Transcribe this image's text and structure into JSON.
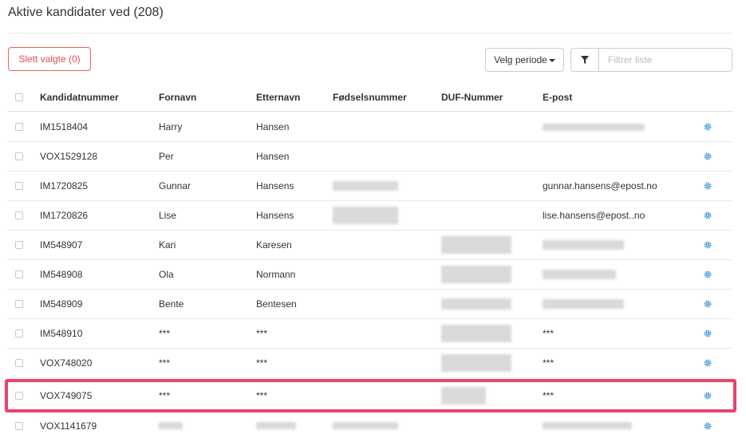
{
  "page": {
    "title": "Aktive kandidater ved (208)"
  },
  "toolbar": {
    "delete_label": "Slett valgte (0)",
    "period_label": "Velg periode",
    "filter_placeholder": "Filtrer liste"
  },
  "table": {
    "headers": {
      "kandidatnummer": "Kandidatnummer",
      "fornavn": "Fornavn",
      "etternavn": "Etternavn",
      "fodselsnummer": "Fødselsnummer",
      "duf": "DUF-Nummer",
      "epost": "E-post"
    },
    "rows": [
      {
        "kandidatnummer": "IM1518404",
        "fornavn": "Harry",
        "etternavn": "Hansen",
        "epost": ""
      },
      {
        "kandidatnummer": "VOX1529128",
        "fornavn": "Per",
        "etternavn": "Hansen",
        "epost": ""
      },
      {
        "kandidatnummer": "IM1720825",
        "fornavn": "Gunnar",
        "etternavn": "Hansens",
        "epost": "gunnar.hansens@epost.no"
      },
      {
        "kandidatnummer": "IM1720826",
        "fornavn": "Lise",
        "etternavn": "Hansens",
        "epost": "lise.hansens@epost..no"
      },
      {
        "kandidatnummer": "IM548907",
        "fornavn": "Kari",
        "etternavn": "Karesen",
        "epost": ""
      },
      {
        "kandidatnummer": "IM548908",
        "fornavn": "Ola",
        "etternavn": "Normann",
        "epost": ""
      },
      {
        "kandidatnummer": "IM548909",
        "fornavn": "Bente",
        "etternavn": "Bentesen",
        "epost": ""
      },
      {
        "kandidatnummer": "IM548910",
        "fornavn": "***",
        "etternavn": "***",
        "epost": "***"
      },
      {
        "kandidatnummer": "VOX748020",
        "fornavn": "***",
        "etternavn": "***",
        "epost": "***"
      },
      {
        "kandidatnummer": "VOX749075",
        "fornavn": "***",
        "etternavn": "***",
        "epost": "***"
      },
      {
        "kandidatnummer": "VOX1141679",
        "fornavn": "",
        "etternavn": "",
        "epost": ""
      }
    ]
  },
  "icons": {
    "filter": "filter-icon",
    "settings": "gear-icon",
    "caret": "caret-down-icon"
  },
  "colors": {
    "accent": "#4a9fd8",
    "danger": "#d9534f",
    "highlight": "#e8436e"
  }
}
